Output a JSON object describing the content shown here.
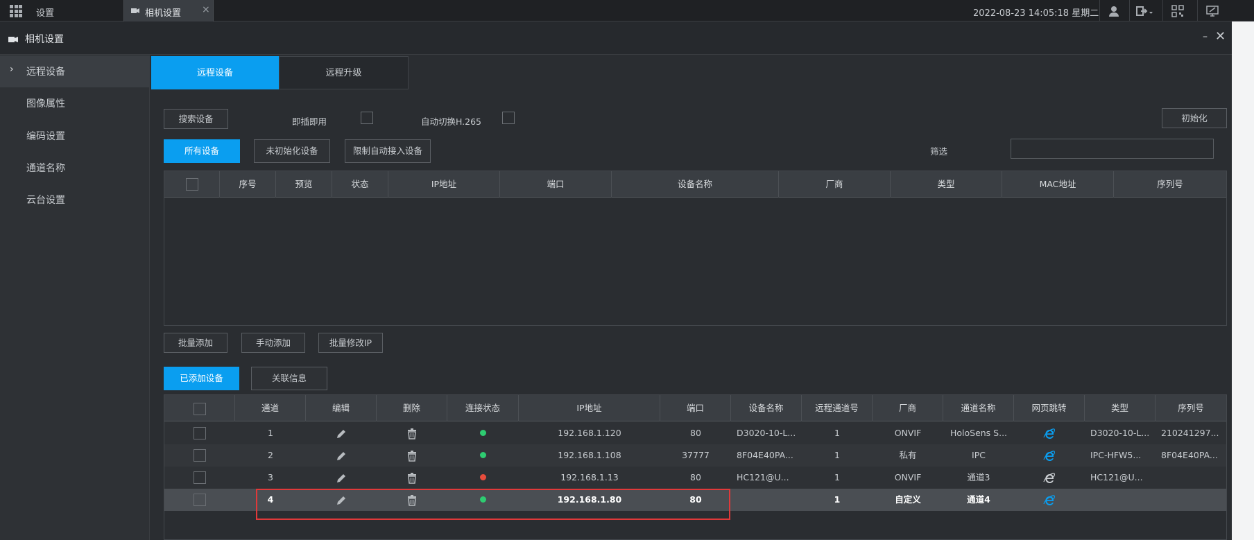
{
  "topbar": {
    "app_title": "设置",
    "active_tab": "相机设置",
    "close_tab_glyph": "×",
    "datetime": "2022-08-23 14:05:18 星期二",
    "icons": [
      "grid-icon",
      "user-icon",
      "logout-icon",
      "qrcode-icon",
      "monitor-icon"
    ]
  },
  "subheader": {
    "title": "相机设置",
    "minimize_glyph": "–",
    "close_glyph": "✕"
  },
  "sidebar": {
    "items": [
      {
        "label": "远程设备",
        "active": true
      },
      {
        "label": "图像属性"
      },
      {
        "label": "编码设置"
      },
      {
        "label": "通道名称"
      },
      {
        "label": "云台设置"
      }
    ]
  },
  "page_tabs": [
    {
      "label": "远程设备",
      "active": true
    },
    {
      "label": "远程升级"
    }
  ],
  "toolbar": {
    "search_button": "搜索设备",
    "plug_play_label": "即插即用",
    "auto_h265_label": "自动切换H.265",
    "init_button": "初始化",
    "filter_label": "筛选",
    "filter_value": ""
  },
  "discover_tabs": [
    "所有设备",
    "未初始化设备",
    "限制自动接入设备"
  ],
  "discover_table": {
    "columns": [
      "序号",
      "预览",
      "状态",
      "IP地址",
      "端口",
      "设备名称",
      "厂商",
      "类型",
      "MAC地址",
      "序列号"
    ],
    "rows": []
  },
  "action_buttons": [
    "批量添加",
    "手动添加",
    "批量修改IP"
  ],
  "added_tabs": [
    "已添加设备",
    "关联信息"
  ],
  "added_table": {
    "columns": [
      "通道",
      "编辑",
      "删除",
      "连接状态",
      "IP地址",
      "端口",
      "设备名称",
      "远程通道号",
      "厂商",
      "通道名称",
      "网页跳转",
      "类型",
      "序列号"
    ],
    "rows": [
      {
        "channel": "1",
        "status": "online",
        "ip": "192.168.1.120",
        "port": "80",
        "device_name": "D3020-10-L...",
        "remote_channel": "1",
        "vendor": "ONVIF",
        "channel_name": "HoloSens S...",
        "web_jump": "ie-icon",
        "type": "D3020-10-L...",
        "serial": "210241297...",
        "selected": false
      },
      {
        "channel": "2",
        "status": "online",
        "ip": "192.168.1.108",
        "port": "37777",
        "device_name": "8F04E40PA...",
        "remote_channel": "1",
        "vendor": "私有",
        "channel_name": "IPC",
        "web_jump": "ie-icon",
        "type": "IPC-HFW5...",
        "serial": "8F04E40PA...",
        "selected": false
      },
      {
        "channel": "3",
        "status": "offline",
        "ip": "192.168.1.13",
        "port": "80",
        "device_name": "HC121@U...",
        "remote_channel": "1",
        "vendor": "ONVIF",
        "channel_name": "通道3",
        "web_jump": "ie-icon-gray",
        "type": "HC121@U...",
        "serial": "",
        "selected": false
      },
      {
        "channel": "4",
        "status": "online",
        "ip": "192.168.1.80",
        "port": "80",
        "device_name": "",
        "remote_channel": "1",
        "vendor": "自定义",
        "channel_name": "通道4",
        "web_jump": "ie-icon",
        "type": "",
        "serial": "",
        "selected": true
      }
    ]
  },
  "colors": {
    "accent": "#0a9ef0",
    "online": "#2ecc71",
    "offline": "#e74c3c",
    "highlight": "#e0393a"
  }
}
